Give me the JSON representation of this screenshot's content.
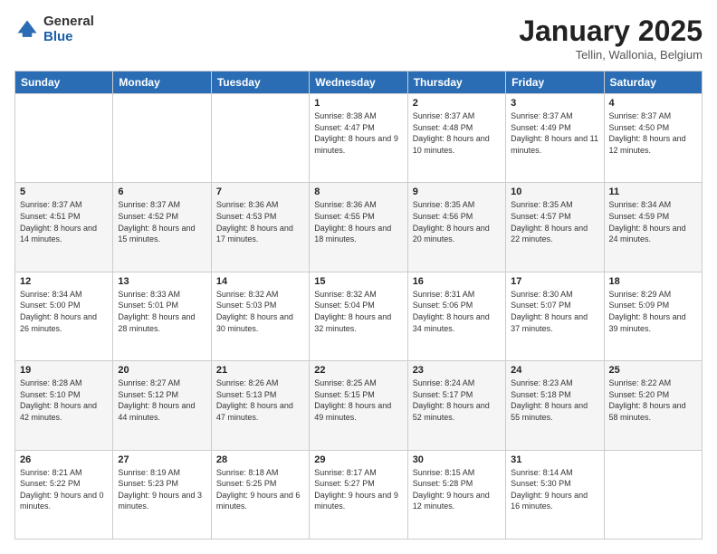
{
  "logo": {
    "general": "General",
    "blue": "Blue"
  },
  "header": {
    "title": "January 2025",
    "subtitle": "Tellin, Wallonia, Belgium"
  },
  "weekdays": [
    "Sunday",
    "Monday",
    "Tuesday",
    "Wednesday",
    "Thursday",
    "Friday",
    "Saturday"
  ],
  "weeks": [
    [
      {
        "day": "",
        "sunrise": "",
        "sunset": "",
        "daylight": ""
      },
      {
        "day": "",
        "sunrise": "",
        "sunset": "",
        "daylight": ""
      },
      {
        "day": "",
        "sunrise": "",
        "sunset": "",
        "daylight": ""
      },
      {
        "day": "1",
        "sunrise": "Sunrise: 8:38 AM",
        "sunset": "Sunset: 4:47 PM",
        "daylight": "Daylight: 8 hours and 9 minutes."
      },
      {
        "day": "2",
        "sunrise": "Sunrise: 8:37 AM",
        "sunset": "Sunset: 4:48 PM",
        "daylight": "Daylight: 8 hours and 10 minutes."
      },
      {
        "day": "3",
        "sunrise": "Sunrise: 8:37 AM",
        "sunset": "Sunset: 4:49 PM",
        "daylight": "Daylight: 8 hours and 11 minutes."
      },
      {
        "day": "4",
        "sunrise": "Sunrise: 8:37 AM",
        "sunset": "Sunset: 4:50 PM",
        "daylight": "Daylight: 8 hours and 12 minutes."
      }
    ],
    [
      {
        "day": "5",
        "sunrise": "Sunrise: 8:37 AM",
        "sunset": "Sunset: 4:51 PM",
        "daylight": "Daylight: 8 hours and 14 minutes."
      },
      {
        "day": "6",
        "sunrise": "Sunrise: 8:37 AM",
        "sunset": "Sunset: 4:52 PM",
        "daylight": "Daylight: 8 hours and 15 minutes."
      },
      {
        "day": "7",
        "sunrise": "Sunrise: 8:36 AM",
        "sunset": "Sunset: 4:53 PM",
        "daylight": "Daylight: 8 hours and 17 minutes."
      },
      {
        "day": "8",
        "sunrise": "Sunrise: 8:36 AM",
        "sunset": "Sunset: 4:55 PM",
        "daylight": "Daylight: 8 hours and 18 minutes."
      },
      {
        "day": "9",
        "sunrise": "Sunrise: 8:35 AM",
        "sunset": "Sunset: 4:56 PM",
        "daylight": "Daylight: 8 hours and 20 minutes."
      },
      {
        "day": "10",
        "sunrise": "Sunrise: 8:35 AM",
        "sunset": "Sunset: 4:57 PM",
        "daylight": "Daylight: 8 hours and 22 minutes."
      },
      {
        "day": "11",
        "sunrise": "Sunrise: 8:34 AM",
        "sunset": "Sunset: 4:59 PM",
        "daylight": "Daylight: 8 hours and 24 minutes."
      }
    ],
    [
      {
        "day": "12",
        "sunrise": "Sunrise: 8:34 AM",
        "sunset": "Sunset: 5:00 PM",
        "daylight": "Daylight: 8 hours and 26 minutes."
      },
      {
        "day": "13",
        "sunrise": "Sunrise: 8:33 AM",
        "sunset": "Sunset: 5:01 PM",
        "daylight": "Daylight: 8 hours and 28 minutes."
      },
      {
        "day": "14",
        "sunrise": "Sunrise: 8:32 AM",
        "sunset": "Sunset: 5:03 PM",
        "daylight": "Daylight: 8 hours and 30 minutes."
      },
      {
        "day": "15",
        "sunrise": "Sunrise: 8:32 AM",
        "sunset": "Sunset: 5:04 PM",
        "daylight": "Daylight: 8 hours and 32 minutes."
      },
      {
        "day": "16",
        "sunrise": "Sunrise: 8:31 AM",
        "sunset": "Sunset: 5:06 PM",
        "daylight": "Daylight: 8 hours and 34 minutes."
      },
      {
        "day": "17",
        "sunrise": "Sunrise: 8:30 AM",
        "sunset": "Sunset: 5:07 PM",
        "daylight": "Daylight: 8 hours and 37 minutes."
      },
      {
        "day": "18",
        "sunrise": "Sunrise: 8:29 AM",
        "sunset": "Sunset: 5:09 PM",
        "daylight": "Daylight: 8 hours and 39 minutes."
      }
    ],
    [
      {
        "day": "19",
        "sunrise": "Sunrise: 8:28 AM",
        "sunset": "Sunset: 5:10 PM",
        "daylight": "Daylight: 8 hours and 42 minutes."
      },
      {
        "day": "20",
        "sunrise": "Sunrise: 8:27 AM",
        "sunset": "Sunset: 5:12 PM",
        "daylight": "Daylight: 8 hours and 44 minutes."
      },
      {
        "day": "21",
        "sunrise": "Sunrise: 8:26 AM",
        "sunset": "Sunset: 5:13 PM",
        "daylight": "Daylight: 8 hours and 47 minutes."
      },
      {
        "day": "22",
        "sunrise": "Sunrise: 8:25 AM",
        "sunset": "Sunset: 5:15 PM",
        "daylight": "Daylight: 8 hours and 49 minutes."
      },
      {
        "day": "23",
        "sunrise": "Sunrise: 8:24 AM",
        "sunset": "Sunset: 5:17 PM",
        "daylight": "Daylight: 8 hours and 52 minutes."
      },
      {
        "day": "24",
        "sunrise": "Sunrise: 8:23 AM",
        "sunset": "Sunset: 5:18 PM",
        "daylight": "Daylight: 8 hours and 55 minutes."
      },
      {
        "day": "25",
        "sunrise": "Sunrise: 8:22 AM",
        "sunset": "Sunset: 5:20 PM",
        "daylight": "Daylight: 8 hours and 58 minutes."
      }
    ],
    [
      {
        "day": "26",
        "sunrise": "Sunrise: 8:21 AM",
        "sunset": "Sunset: 5:22 PM",
        "daylight": "Daylight: 9 hours and 0 minutes."
      },
      {
        "day": "27",
        "sunrise": "Sunrise: 8:19 AM",
        "sunset": "Sunset: 5:23 PM",
        "daylight": "Daylight: 9 hours and 3 minutes."
      },
      {
        "day": "28",
        "sunrise": "Sunrise: 8:18 AM",
        "sunset": "Sunset: 5:25 PM",
        "daylight": "Daylight: 9 hours and 6 minutes."
      },
      {
        "day": "29",
        "sunrise": "Sunrise: 8:17 AM",
        "sunset": "Sunset: 5:27 PM",
        "daylight": "Daylight: 9 hours and 9 minutes."
      },
      {
        "day": "30",
        "sunrise": "Sunrise: 8:15 AM",
        "sunset": "Sunset: 5:28 PM",
        "daylight": "Daylight: 9 hours and 12 minutes."
      },
      {
        "day": "31",
        "sunrise": "Sunrise: 8:14 AM",
        "sunset": "Sunset: 5:30 PM",
        "daylight": "Daylight: 9 hours and 16 minutes."
      },
      {
        "day": "",
        "sunrise": "",
        "sunset": "",
        "daylight": ""
      }
    ]
  ]
}
